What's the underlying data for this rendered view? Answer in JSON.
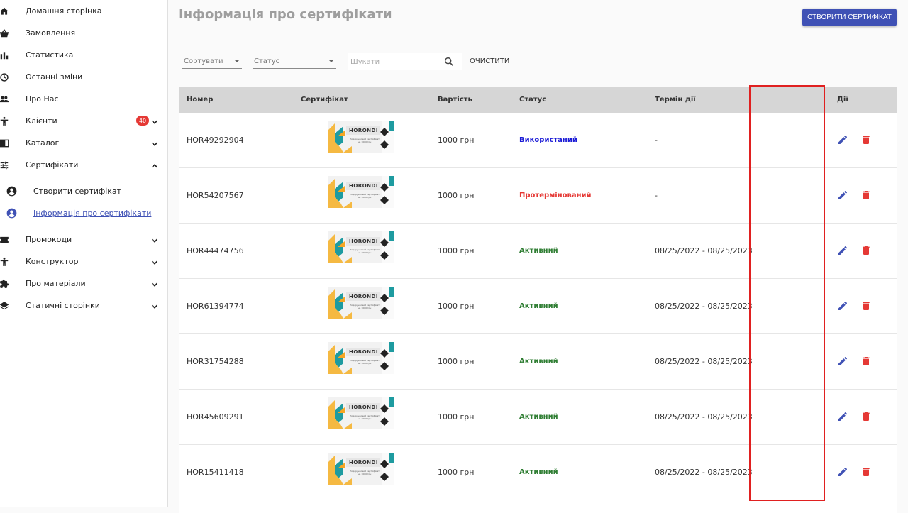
{
  "sidebar": {
    "items": [
      {
        "label": "Домашня сторінка",
        "icon": "home-icon"
      },
      {
        "label": "Замовлення",
        "icon": "basket-icon"
      },
      {
        "label": "Статистика",
        "icon": "bar-chart-icon"
      },
      {
        "label": "Останні зміни",
        "icon": "history-icon"
      },
      {
        "label": "Про Нас",
        "icon": "people-icon"
      },
      {
        "label": "Клієнти",
        "icon": "person-icon",
        "badge": "40"
      },
      {
        "label": "Каталог",
        "icon": "book-icon"
      },
      {
        "label": "Сертифікати",
        "icon": "tune-icon"
      },
      {
        "label": "Промокоди",
        "icon": "ticket-icon"
      },
      {
        "label": "Конструктор",
        "icon": "accessibility-icon"
      },
      {
        "label": "Про матеріали",
        "icon": "puzzle-icon"
      },
      {
        "label": "Статичні сторінки",
        "icon": "layers-icon"
      }
    ],
    "sub_items": [
      {
        "label": "Створити сертифікат"
      },
      {
        "label": "Інформація про сертифікати"
      }
    ]
  },
  "header": {
    "title": "Інформація про сертифікати",
    "create_button": "СТВОРИТИ СЕРТИФІКАТ"
  },
  "filters": {
    "sort_label": "Сортувати",
    "status_label": "Статус",
    "search_placeholder": "Шукати",
    "clear_label": "ОЧИСТИТИ"
  },
  "table": {
    "headers": [
      "Номер",
      "Сертифікат",
      "Вартість",
      "Статус",
      "Термін дії",
      "Дії"
    ],
    "rows": [
      {
        "number": "HOR49292904",
        "price": "1000 грн",
        "status": "Використаний",
        "term": "-"
      },
      {
        "number": "HOR54207567",
        "price": "1000 грн",
        "status": "Протермінований",
        "term": "-"
      },
      {
        "number": "HOR44474756",
        "price": "1000 грн",
        "status": "Активний",
        "term": "08/25/2022 - 08/25/2023"
      },
      {
        "number": "HOR61394774",
        "price": "1000 грн",
        "status": "Активний",
        "term": "08/25/2022 - 08/25/2023"
      },
      {
        "number": "HOR31754288",
        "price": "1000 грн",
        "status": "Активний",
        "term": "08/25/2022 - 08/25/2023"
      },
      {
        "number": "HOR45609291",
        "price": "1000 грн",
        "status": "Активний",
        "term": "08/25/2022 - 08/25/2023"
      },
      {
        "number": "HOR15411418",
        "price": "1000 грн",
        "status": "Активний",
        "term": "08/25/2022 - 08/25/2023"
      }
    ]
  },
  "certificate": {
    "brand": "HORONDI",
    "caption": "Подарунковий сертифікат на 1000 грн"
  },
  "colors": {
    "accent": "#3f51b5",
    "status_used": "#1a1ad6",
    "status_expired": "#e53935",
    "status_active": "#2e7d32",
    "delete": "#e53935",
    "badge": "#e53935",
    "highlight": "#e02020"
  }
}
